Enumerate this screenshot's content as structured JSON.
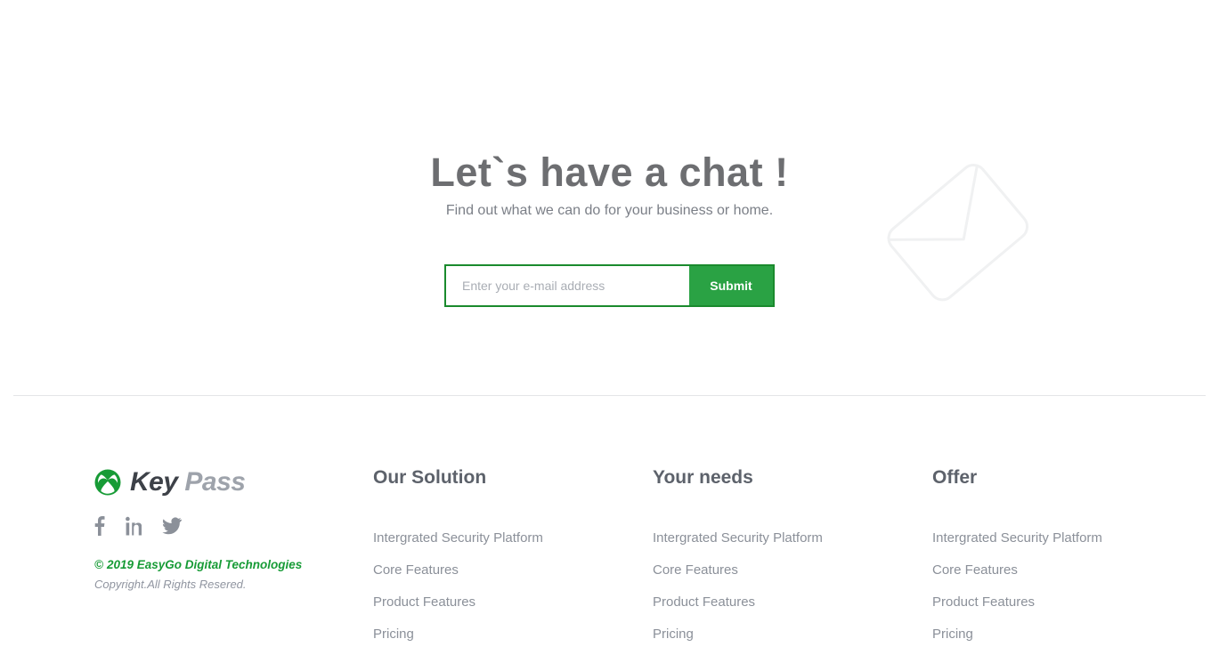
{
  "cta": {
    "heading": "Let`s have a chat !",
    "subheading": "Find out what we can do for your business or home.",
    "email_placeholder": "Enter your e-mail address",
    "email_value": "",
    "submit_label": "Submit",
    "envelope_icon": "envelope-outline-icon",
    "accent_green": "#2aa244",
    "border_green": "#1a8a2d"
  },
  "footer": {
    "brand": {
      "mark_icon": "xbox-sphere-logo-icon",
      "name_primary": "Key",
      "name_secondary": "Pass",
      "mark_color": "#179b36"
    },
    "social": [
      {
        "name": "facebook-icon",
        "label": "f"
      },
      {
        "name": "linkedin-icon",
        "label": "in"
      },
      {
        "name": "twitter-icon",
        "label": "twitter bird"
      }
    ],
    "copyright_primary": "2019 EasyGo Digital Technologies",
    "copyright_symbol": "©",
    "copyright_secondary": "Copyright.All Rights Resered.",
    "columns": [
      {
        "title": "Our Solution",
        "links": [
          "Intergrated Security Platform",
          "Core Features",
          "Product Features",
          "Pricing"
        ]
      },
      {
        "title": "Your needs",
        "links": [
          "Intergrated Security Platform",
          "Core Features",
          "Product Features",
          "Pricing"
        ]
      },
      {
        "title": "Offer",
        "links": [
          "Intergrated Security Platform",
          "Core Features",
          "Product Features",
          "Pricing"
        ]
      }
    ]
  }
}
